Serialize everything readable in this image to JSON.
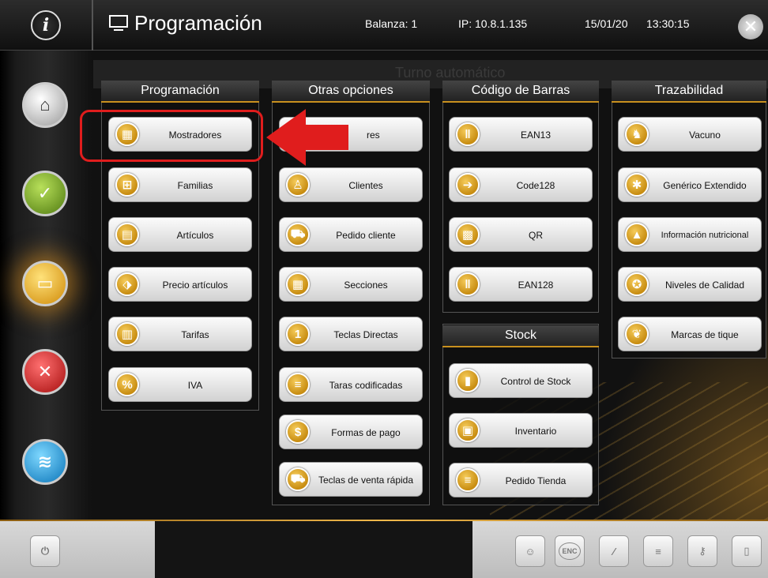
{
  "header": {
    "info_glyph": "i",
    "title": "Programación",
    "balanza": "Balanza: 1",
    "ip": "IP: 10.8.1.135",
    "date": "15/01/20",
    "time": "13:30:15"
  },
  "background": {
    "ghost_title": "Turno automático"
  },
  "rail": [
    {
      "name": "home",
      "icon": "home-icon"
    },
    {
      "name": "accept",
      "icon": "check-icon"
    },
    {
      "name": "programming",
      "icon": "monitor-icon",
      "active": true
    },
    {
      "name": "tools",
      "icon": "tools-icon"
    },
    {
      "name": "network",
      "icon": "wifi-icon"
    }
  ],
  "columns": {
    "programacion": {
      "title": "Programación",
      "items": [
        "Mostradores",
        "Familias",
        "Artículos",
        "Precio artículos",
        "Tarifas",
        "IVA"
      ]
    },
    "otras": {
      "title": "Otras opciones",
      "items": [
        "Vendedores",
        "Clientes",
        "Pedido cliente",
        "Secciones",
        "Teclas Directas",
        "Taras codificadas",
        "Formas de pago",
        "Teclas de venta rápida"
      ],
      "visible_first": "res"
    },
    "barras": {
      "title": "Código de Barras",
      "items": [
        "EAN13",
        "Code128",
        "QR",
        "EAN128"
      ]
    },
    "stock": {
      "title": "Stock",
      "items": [
        "Control de Stock",
        "Inventario",
        "Pedido Tienda"
      ]
    },
    "trazabilidad": {
      "title": "Trazabilidad",
      "items": [
        "Vacuno",
        "Genérico Extendido",
        "Información nutricional",
        "Niveles de Calidad",
        "Marcas de tique"
      ]
    }
  },
  "bottom": {
    "enc_label": "ENC"
  },
  "colors": {
    "accent": "#c8901e",
    "highlight": "#e01d1d"
  }
}
